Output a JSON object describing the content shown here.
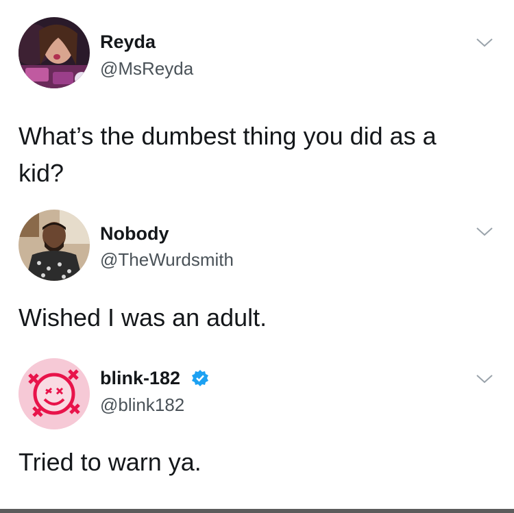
{
  "tweets": [
    {
      "name": "Reyda",
      "handle": "@MsReyda",
      "text_line1": "What’s the dumbest thing you did as a",
      "text_line2": "kid?",
      "avatar_icon": "person-photo",
      "menu_icon": "chevron-down-icon"
    },
    {
      "name": "Nobody",
      "handle": "@TheWurdsmith",
      "text_line1": "Wished I was an adult.",
      "avatar_icon": "person-photo",
      "menu_icon": "chevron-down-icon"
    },
    {
      "name": "blink-182",
      "handle": "@blink182",
      "verified": true,
      "text_line1": "Tried to warn ya.",
      "avatar_icon": "smiley-logo",
      "menu_icon": "chevron-down-icon"
    }
  ],
  "colors": {
    "text": "#14171a",
    "handle": "#4a5258",
    "chevron": "#9aa3ab",
    "verified": "#1da1f2",
    "blink_avatar_bg": "#f6c9d6",
    "blink_logo": "#e8134a"
  }
}
